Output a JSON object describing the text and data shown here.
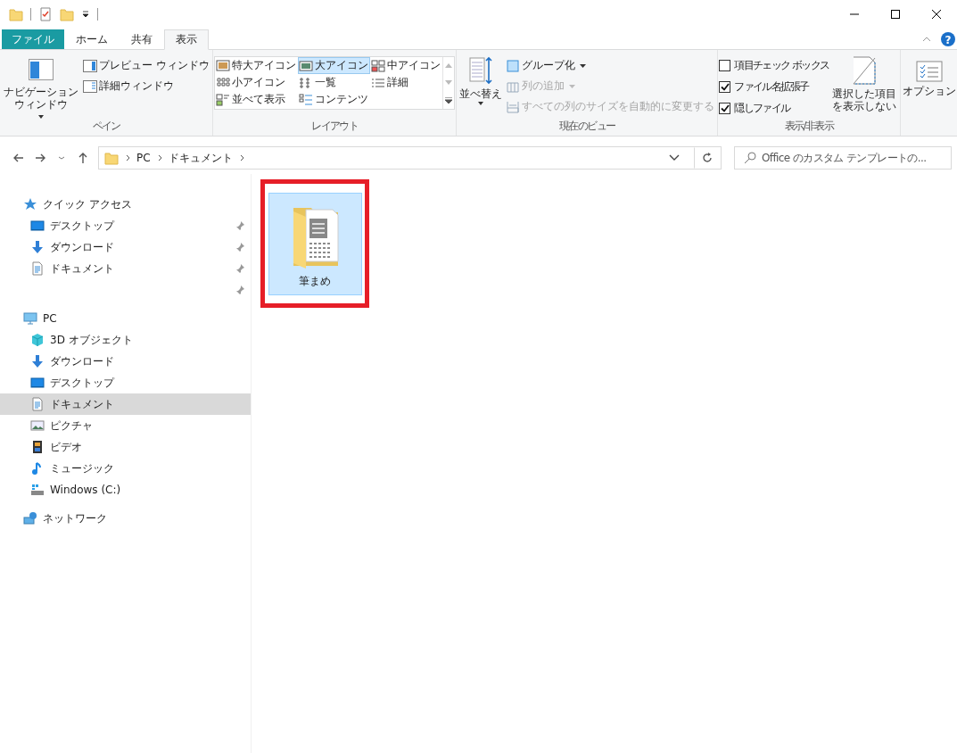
{
  "help_button": "?",
  "tabs": [
    {
      "label": "ファイル",
      "kind": "file",
      "selected": false
    },
    {
      "label": "ホーム",
      "kind": "normal",
      "selected": false
    },
    {
      "label": "共有",
      "kind": "normal",
      "selected": false
    },
    {
      "label": "表示",
      "kind": "normal",
      "selected": true
    }
  ],
  "ribbon": {
    "pane": {
      "label": "ペイン",
      "nav_button": "ナビゲーションウィンドウ",
      "buttons": [
        {
          "label": "プレビュー ウィンドウ",
          "kind": "preview"
        },
        {
          "label": "詳細ウィンドウ",
          "kind": "details"
        }
      ]
    },
    "layout": {
      "label": "レイアウト",
      "items": [
        {
          "label": "特大アイコン",
          "kind": "xl",
          "selected": false
        },
        {
          "label": "大アイコン",
          "kind": "large",
          "selected": true
        },
        {
          "label": "中アイコン",
          "kind": "medium",
          "selected": false
        },
        {
          "label": "小アイコン",
          "kind": "small",
          "selected": false
        },
        {
          "label": "一覧",
          "kind": "list",
          "selected": false
        },
        {
          "label": "詳細",
          "kind": "details",
          "selected": false
        },
        {
          "label": "並べて表示",
          "kind": "tiles",
          "selected": false
        },
        {
          "label": "コンテンツ",
          "kind": "content",
          "selected": false
        }
      ]
    },
    "current_view": {
      "label": "現在のビュー",
      "sort_button": "並べ替え",
      "commands": [
        {
          "label": "グループ化",
          "kind": "group",
          "dropdown": true,
          "disabled": false
        },
        {
          "label": "列の追加",
          "kind": "columns",
          "dropdown": true,
          "disabled": true
        },
        {
          "label": "すべての列のサイズを自動的に変更する",
          "kind": "resize",
          "dropdown": false,
          "disabled": true
        }
      ]
    },
    "show_hide": {
      "label": "表示/非表示",
      "checkboxes": [
        {
          "label": "項目チェック ボックス",
          "checked": false
        },
        {
          "label": "ファイル名拡張子",
          "checked": true
        },
        {
          "label": "隠しファイル",
          "checked": true
        }
      ],
      "hide_button": "選択した項目を表示しない"
    },
    "options": {
      "label": "オプション"
    }
  },
  "address": {
    "path": [
      "PC",
      "ドキュメント"
    ],
    "search_placeholder": "Office のカスタム テンプレートの..."
  },
  "sidebar": [
    {
      "label": "クイック アクセス",
      "kind": "quick",
      "selected": false,
      "children": [
        {
          "label": "デスクトップ",
          "kind": "desktop",
          "pinned": true,
          "selected": false
        },
        {
          "label": "ダウンロード",
          "kind": "download",
          "pinned": true,
          "selected": false
        },
        {
          "label": "ドキュメント",
          "kind": "document",
          "pinned": true,
          "selected": false
        },
        {
          "kind": "blank",
          "pinned": true,
          "selected": false
        }
      ]
    },
    {
      "label": "PC",
      "kind": "pc",
      "selected": false,
      "children": [
        {
          "label": "3D オブジェクト",
          "kind": "objects3d",
          "pinned": false,
          "selected": false
        },
        {
          "label": "ダウンロード",
          "kind": "download",
          "pinned": false,
          "selected": false
        },
        {
          "label": "デスクトップ",
          "kind": "desktop",
          "pinned": false,
          "selected": false
        },
        {
          "label": "ドキュメント",
          "kind": "document",
          "pinned": false,
          "selected": true
        },
        {
          "label": "ピクチャ",
          "kind": "pictures",
          "pinned": false,
          "selected": false
        },
        {
          "label": "ビデオ",
          "kind": "videos",
          "pinned": false,
          "selected": false
        },
        {
          "label": "ミュージック",
          "kind": "music",
          "pinned": false,
          "selected": false
        },
        {
          "label": "Windows (C:)",
          "kind": "drive",
          "pinned": false,
          "selected": false
        }
      ]
    },
    {
      "label": "ネットワーク",
      "kind": "network",
      "selected": false
    }
  ],
  "files": [
    {
      "name": "筆まめ",
      "selected": true,
      "highlighted": true
    }
  ]
}
